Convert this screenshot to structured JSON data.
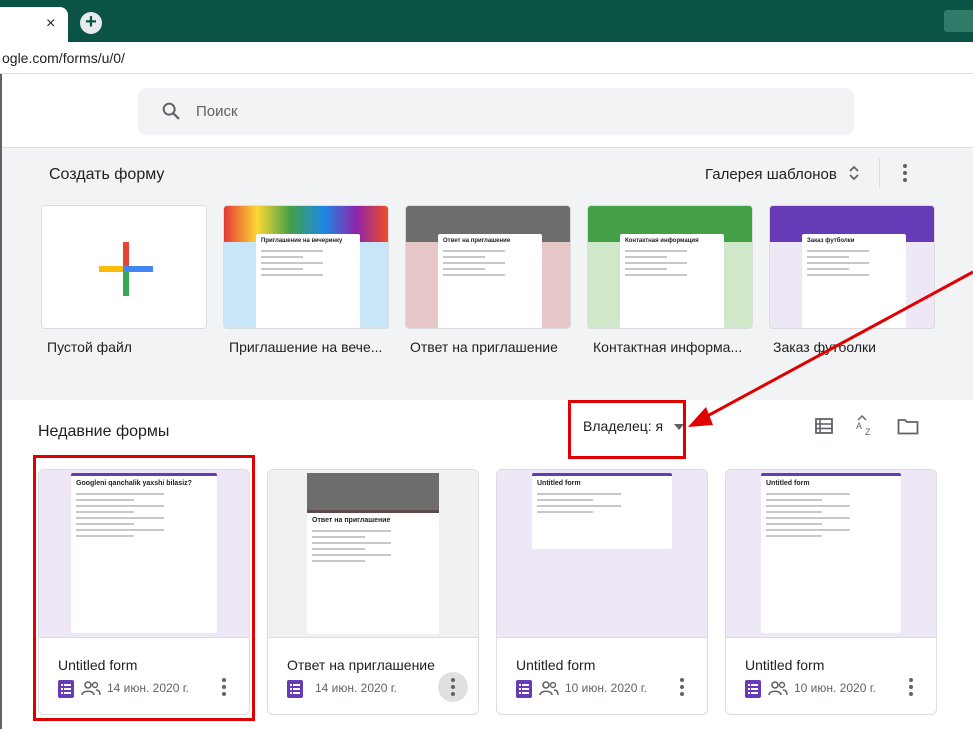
{
  "browser": {
    "tab_close": "×",
    "new_tab": "+",
    "url": "ogle.com/forms/u/0/"
  },
  "search": {
    "placeholder": "Поиск"
  },
  "gallery": {
    "title": "Создать форму",
    "link": "Галерея шаблонов",
    "templates": [
      {
        "label": "Пустой файл",
        "mini_title": ""
      },
      {
        "label": "Приглашение на вече...",
        "mini_title": "Приглашение на вечеринку"
      },
      {
        "label": "Ответ на приглашение",
        "mini_title": "Ответ на приглашение"
      },
      {
        "label": "Контактная информа...",
        "mini_title": "Контактная информация"
      },
      {
        "label": "Заказ футболки",
        "mini_title": "Заказ футболки"
      }
    ]
  },
  "recent": {
    "title": "Недавние формы",
    "owner_filter": "Владелец: я",
    "forms": [
      {
        "title": "Untitled form",
        "date": "14 июн. 2020 г.",
        "shared": true,
        "thumb_title": "Googleni qanchalik yaxshi bilasiz?"
      },
      {
        "title": "Ответ на приглашение",
        "date": "14 июн. 2020 г.",
        "shared": false,
        "thumb_title": "Ответ на приглашение"
      },
      {
        "title": "Untitled form",
        "date": "10 июн. 2020 г.",
        "shared": true,
        "thumb_title": "Untitled form"
      },
      {
        "title": "Untitled form",
        "date": "10 июн. 2020 г.",
        "shared": true,
        "thumb_title": "Untitled form"
      }
    ]
  },
  "colors": {
    "forms_purple": "#673ab7",
    "tab_bar": "#0b5345",
    "annotation_red": "#e00000"
  }
}
